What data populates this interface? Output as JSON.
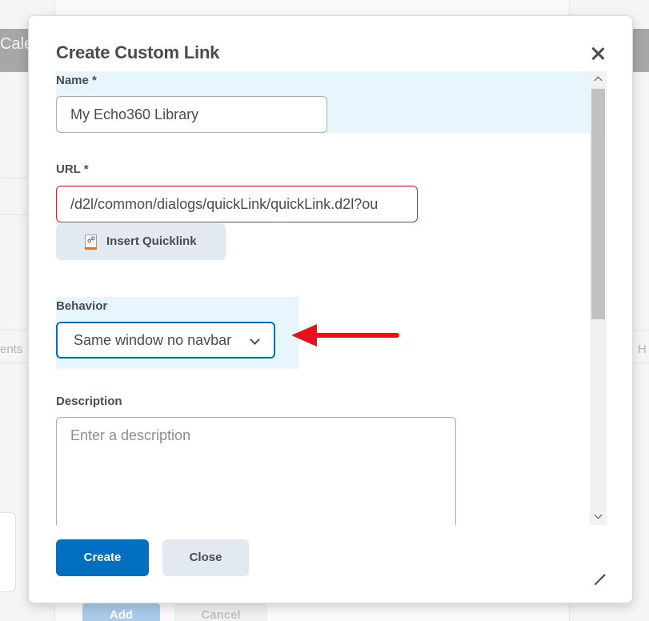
{
  "background": {
    "header_text": "Cale",
    "tab_left_text": "ents",
    "tab_right_text": "H",
    "add_label": "Add",
    "cancel_label": "Cancel"
  },
  "dialog": {
    "title": "Create Custom Link",
    "close_icon": "close-icon",
    "name": {
      "label": "Name *",
      "value": "My Echo360 Library"
    },
    "url": {
      "label": "URL *",
      "value": "/d2l/common/dialogs/quickLink/quickLink.d2l?ou"
    },
    "quicklink": {
      "label": "Insert Quicklink",
      "icon": "quicklink-icon"
    },
    "behavior": {
      "label": "Behavior",
      "selected": "Same window no navbar"
    },
    "description": {
      "label": "Description",
      "placeholder": "Enter a description"
    },
    "footer": {
      "create_label": "Create",
      "close_label": "Close"
    }
  },
  "colors": {
    "primary": "#006fbf",
    "error_border": "#cd2026",
    "highlight": "#e6f6fc",
    "annotation_arrow": "#e8131a"
  }
}
